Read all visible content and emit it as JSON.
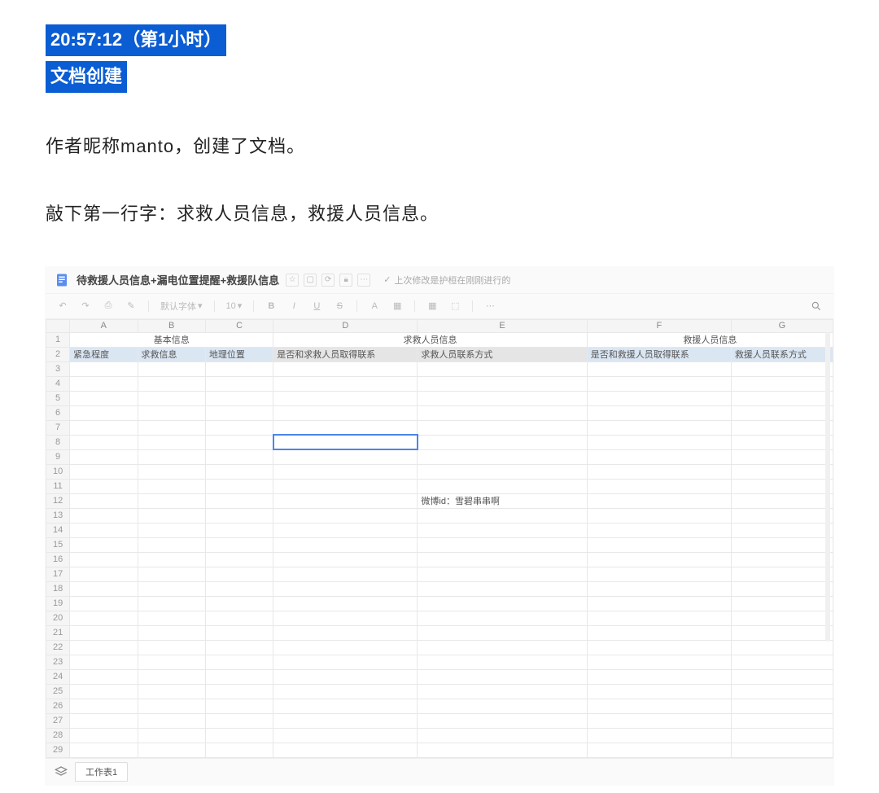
{
  "article": {
    "timestamp_line": "20:57:12（第1小时）",
    "title_line": "文档创建",
    "para1": "作者昵称manto，创建了文档。",
    "para2": "敲下第一行字：求救人员信息，救援人员信息。"
  },
  "sheet": {
    "doc_title": "待救援人员信息+漏电位置提醒+救援队信息",
    "revision_note": "上次修改是护桓在刚刚进行的",
    "toolbar": {
      "font_label": "默认字体",
      "font_size": "10",
      "bold": "B",
      "italic": "I",
      "underline": "U",
      "strike": "S",
      "textcolor": "A"
    },
    "columns": [
      "A",
      "B",
      "C",
      "D",
      "E",
      "F",
      "G"
    ],
    "row_count": 29,
    "merged_headers": {
      "ABC": "基本信息",
      "DE": "求救人员信息",
      "FG": "救援人员信息"
    },
    "row2": {
      "A": "紧急程度",
      "B": "求救信息",
      "C": "地理位置",
      "D": "是否和求救人员取得联系",
      "E": "求救人员联系方式",
      "F": "是否和救援人员取得联系",
      "G": "救援人员联系方式"
    },
    "active_cell": "D8",
    "cells": {
      "E12": "微博id：雪碧串串啊"
    },
    "footer_tab": "工作表1"
  }
}
